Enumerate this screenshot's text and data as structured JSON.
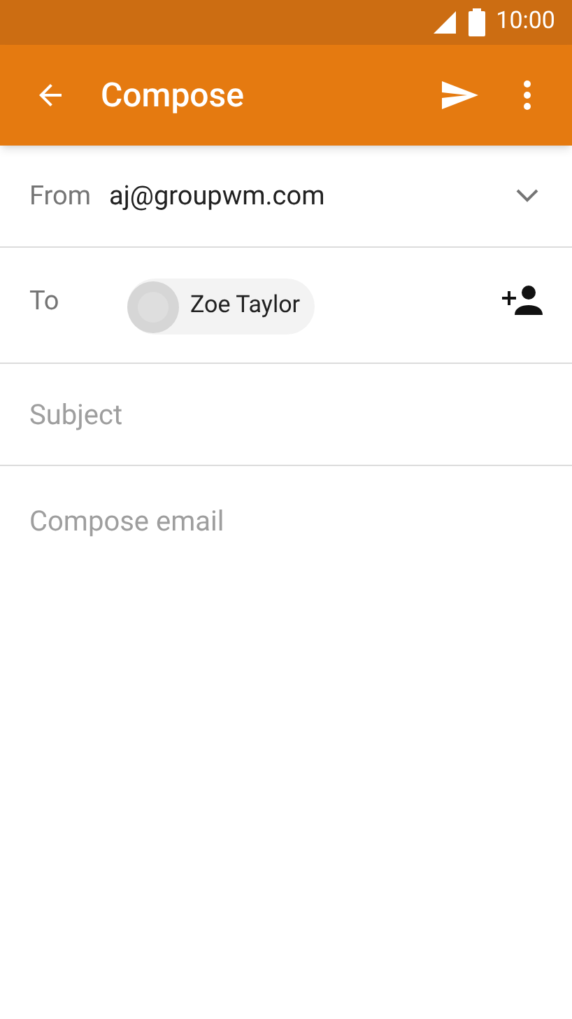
{
  "status_bar": {
    "time": "10:00"
  },
  "app_bar": {
    "title": "Compose"
  },
  "from": {
    "label": "From",
    "value": "aj@groupwm.com"
  },
  "to": {
    "label": "To",
    "recipients": [
      {
        "name": "Zoe Taylor"
      }
    ]
  },
  "subject": {
    "placeholder": "Subject"
  },
  "body": {
    "placeholder": "Compose email"
  }
}
